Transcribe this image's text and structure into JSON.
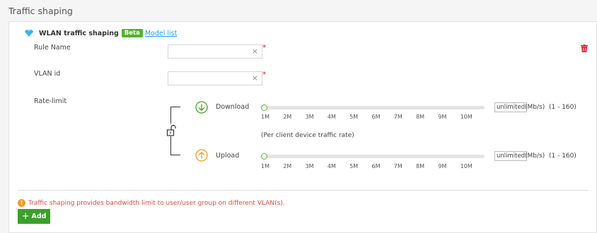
{
  "section": {
    "title": "Traffic shaping"
  },
  "header": {
    "title": "WLAN traffic shaping",
    "beta": "Beta",
    "model_link": "Model list"
  },
  "form": {
    "rule_name_label": "Rule Name",
    "rule_name_value": "",
    "vlan_label": "VLAN id",
    "vlan_value": "",
    "required_mark": "*",
    "clear_glyph": "×"
  },
  "rate_limit": {
    "label": "Rate-limit",
    "hint": "(Per client device traffic rate)",
    "download": {
      "label": "Download",
      "value": "unlimited",
      "unit": "(Mb/s)",
      "range": "(1 - 160)",
      "slider_fraction": 0
    },
    "upload": {
      "label": "Upload",
      "value": "unlimited",
      "unit": "(Mb/s)",
      "range": "(1 - 160)",
      "slider_fraction": 0
    },
    "ticks": [
      "1M",
      "2M",
      "3M",
      "4M",
      "5M",
      "6M",
      "7M",
      "8M",
      "9M",
      "10M"
    ]
  },
  "footer": {
    "warning_glyph": "!",
    "warning": "Traffic shaping provides bandwidth limit to user/user group on different VLAN(s).",
    "add_plus": "+",
    "add_label": "Add"
  },
  "colors": {
    "accent_green": "#3aa02a",
    "beta_green": "#52b32a",
    "link_blue": "#1a9fd8",
    "delete_red": "#e0202d",
    "upload_orange": "#f39a1e",
    "warning_red": "#e2483d"
  }
}
